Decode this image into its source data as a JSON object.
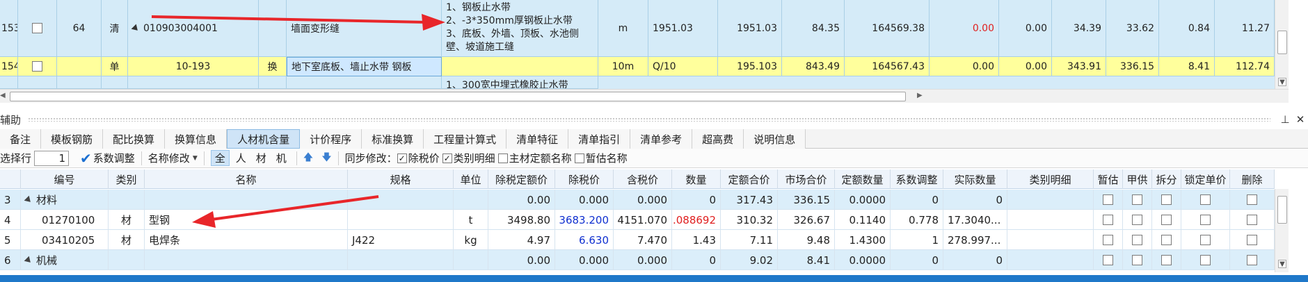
{
  "top_rows": [
    {
      "row_no": "153",
      "seq": "64",
      "type": "清",
      "code": "010903004001",
      "name": "墙面变形缝",
      "feature_lines": [
        "1、钢板止水带",
        "2、-3*350mm厚钢板止水带",
        "3、底板、外墙、顶板、水池侧",
        "壁、坡道施工缝"
      ],
      "unit": "m",
      "expr": "1951.03",
      "qty": "1951.03",
      "price": "84.35",
      "total": "164569.38",
      "v1": "0.00",
      "v2": "0.00",
      "v3": "34.39",
      "v4": "33.62",
      "v5": "0.84",
      "v6": "11.27"
    },
    {
      "row_no": "154",
      "type": "单",
      "code": "10-193",
      "swap": "换",
      "name": "地下室底板、墙止水带 钢板",
      "unit": "10m",
      "expr": "Q/10",
      "qty": "195.103",
      "price": "843.49",
      "total": "164567.43",
      "v1": "0.00",
      "v2": "0.00",
      "v3": "343.91",
      "v4": "336.15",
      "v5": "8.41",
      "v6": "112.74"
    },
    {
      "feature_partial": "1、300宽中埋式橡胶止水带"
    }
  ],
  "panel": {
    "title": "辅助"
  },
  "tabs": [
    "备注",
    "模板钢筋",
    "配比换算",
    "换算信息",
    "人材机含量",
    "计价程序",
    "标准换算",
    "工程量计算式",
    "清单特征",
    "清单指引",
    "清单参考",
    "超高费",
    "说明信息"
  ],
  "toolbar": {
    "select_row": "选择行",
    "row_value": "1",
    "coef_adjust": "系数调整",
    "rename": "名称修改",
    "filters": [
      "全",
      "人",
      "材",
      "机"
    ],
    "sync_label": "同步修改：",
    "opt_tax": "除税价",
    "opt_detail": "类别明细",
    "opt_main_name": "主材定额名称",
    "opt_temp_name": "暂估名称"
  },
  "bottom_headers": [
    "编号",
    "类别",
    "名称",
    "规格",
    "单位",
    "除税定额价",
    "除税价",
    "含税价",
    "数量",
    "定额合价",
    "市场合价",
    "定额数量",
    "系数调整",
    "实际数量",
    "类别明细",
    "暂估",
    "甲供",
    "拆分",
    "锁定单价",
    "删除"
  ],
  "bottom_rows": [
    {
      "no": "3",
      "group": true,
      "code": "材料",
      "tax_excl_quota": "0.00",
      "tax_excl": "0.000",
      "tax_incl": "0.000",
      "qty": "0",
      "quota_total": "317.43",
      "market_total": "336.15",
      "quota_qty": "0.0000",
      "coef": "0",
      "actual": "0"
    },
    {
      "no": "4",
      "code": "01270100",
      "cat": "材",
      "name": "型钢",
      "spec": "",
      "unit": "t",
      "tax_excl_quota": "3498.80",
      "tax_excl": "3683.200",
      "tax_incl": "4151.070",
      "qty": "0.088692",
      "quota_total": "310.32",
      "market_total": "326.67",
      "quota_qty": "0.1140",
      "coef": "0.778",
      "actual": "17.3040..."
    },
    {
      "no": "5",
      "code": "03410205",
      "cat": "材",
      "name": "电焊条",
      "spec": "J422",
      "unit": "kg",
      "tax_excl_quota": "4.97",
      "tax_excl": "6.630",
      "tax_incl": "7.470",
      "qty": "1.43",
      "quota_total": "7.11",
      "market_total": "9.48",
      "quota_qty": "1.4300",
      "coef": "1",
      "actual": "278.997..."
    },
    {
      "no": "6",
      "group": true,
      "code": "机械",
      "tax_excl_quota": "0.00",
      "tax_excl": "0.000",
      "tax_incl": "0.000",
      "qty": "0",
      "quota_total": "9.02",
      "market_total": "8.41",
      "quota_qty": "0.0000",
      "coef": "0",
      "actual": "0"
    }
  ],
  "colors": {
    "annotation_arrow": "#e8262a",
    "accent": "#1f78c9",
    "highlight_row": "#ffff9c"
  }
}
